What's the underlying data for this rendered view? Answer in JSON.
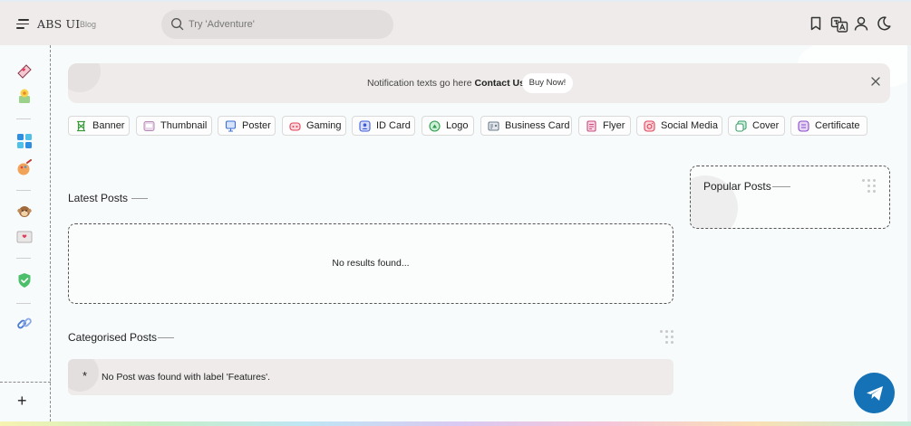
{
  "header": {
    "brand": "ABS UI",
    "brand_sub": "Blog",
    "search_placeholder": "Try 'Adventure'"
  },
  "sidebar": {
    "items": [
      "heart-mail-icon",
      "flower-icon",
      "puzzle-icon",
      "palette-icon",
      "monkey-icon",
      "heart-card-icon",
      "shield-check-icon",
      "link-icon"
    ],
    "add_label": "+"
  },
  "notification": {
    "text": "Notification texts go here",
    "link": "Contact Us",
    "button": "Buy Now!"
  },
  "categories": [
    {
      "label": "Banner",
      "icon": "banner-icon",
      "color": "#3a9d3a"
    },
    {
      "label": "Thumbnail",
      "icon": "thumbnail-icon",
      "color": "#c9a6c9"
    },
    {
      "label": "Poster",
      "icon": "poster-icon",
      "color": "#3d6fd6"
    },
    {
      "label": "Gaming",
      "icon": "gaming-icon",
      "color": "#e0455a"
    },
    {
      "label": "ID Card",
      "icon": "id-card-icon",
      "color": "#3d5bd6"
    },
    {
      "label": "Logo",
      "icon": "logo-icon",
      "color": "#2a9d4a"
    },
    {
      "label": "Business Card",
      "icon": "business-card-icon",
      "color": "#6a7a8a"
    },
    {
      "label": "Flyer",
      "icon": "flyer-icon",
      "color": "#c94a7a"
    },
    {
      "label": "Social Media",
      "icon": "social-media-icon",
      "color": "#e0455a"
    },
    {
      "label": "Cover",
      "icon": "cover-icon",
      "color": "#3aa06a"
    },
    {
      "label": "Certificate",
      "icon": "certificate-icon",
      "color": "#8a4ac9"
    }
  ],
  "latest": {
    "title": "Latest Posts",
    "empty": "No results found..."
  },
  "categorised": {
    "title": "Categorised Posts",
    "bullet": "*",
    "message": "No Post was found with label 'Features'."
  },
  "popular": {
    "title": "Popular Posts"
  },
  "colors": {
    "header_bg": "#eeebea",
    "page_bg": "#f7fbfc",
    "send_button": "#1672b6"
  }
}
